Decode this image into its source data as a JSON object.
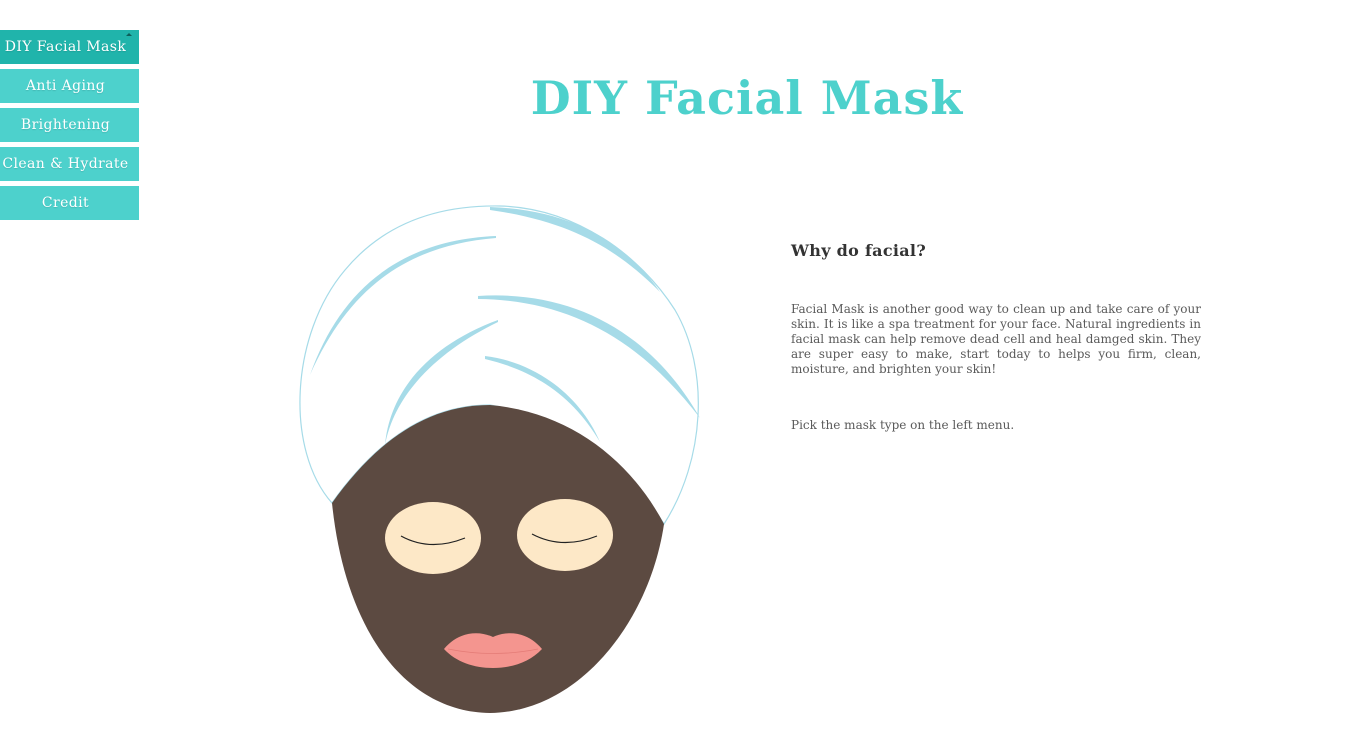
{
  "menu": {
    "items": [
      {
        "label": "DIY Facial Mask",
        "active": true
      },
      {
        "label": "Anti Aging",
        "active": false
      },
      {
        "label": "Brightening",
        "active": false
      },
      {
        "label": "Clean & Hydrate",
        "active": false
      },
      {
        "label": "Credit",
        "active": false
      }
    ]
  },
  "header": {
    "title": "DIY Facial Mask"
  },
  "info": {
    "heading": "Why do facial?",
    "body": "Facial Mask is another good way to clean up and take care of your skin. It is like a spa treatment for your face. Natural ingredients in facial mask can help remove dead cell and heal damged skin. They are super easy to make, start today to helps you firm, clean, moisture, and brighten your skin!",
    "hint": "Pick the mask type on the left menu."
  },
  "colors": {
    "accent": "#4dd1cc",
    "accent_active": "#20b4ab",
    "mask": "#5c4a41",
    "towel_line": "#a6dbe8",
    "cucumber": "#fde8c7",
    "lips": "#f4958f",
    "text": "#5a5a5a"
  }
}
